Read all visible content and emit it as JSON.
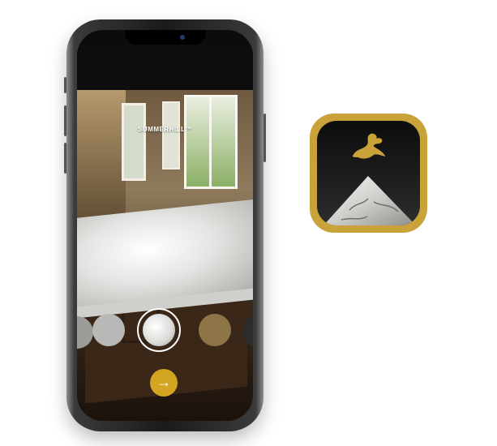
{
  "app": {
    "title": "SUMMERHILL™",
    "back_glyph": "‹",
    "next_glyph": "→",
    "accent_color": "#c9a23a",
    "icons": [
      "dragon-logo-icon",
      "back-chevron-icon",
      "hamburger-menu-icon",
      "arrow-right-icon"
    ]
  },
  "swatches": [
    {
      "name": "grey-marble",
      "color": "#b8b8b6",
      "selected": false
    },
    {
      "name": "summerhill",
      "color": "#e6e6e3",
      "selected": true
    },
    {
      "name": "bronze",
      "color": "#8d7548",
      "selected": false
    }
  ]
}
